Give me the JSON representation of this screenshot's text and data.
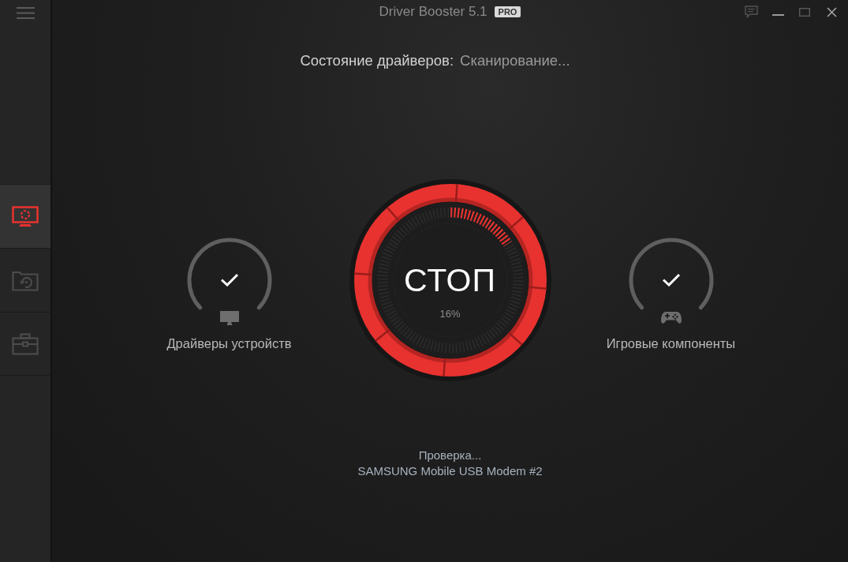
{
  "window": {
    "title": "Driver Booster 5.1",
    "badge": "PRO"
  },
  "sidebar": {
    "items": [
      {
        "kind": "scan",
        "selected": true
      },
      {
        "kind": "restore",
        "selected": false
      },
      {
        "kind": "toolbox",
        "selected": false
      }
    ]
  },
  "status": {
    "label": "Состояние драйверов:",
    "value": "Сканирование..."
  },
  "categories": [
    {
      "kind": "devices",
      "label": "Драйверы устройств",
      "done": true
    },
    {
      "kind": "games",
      "label": "Игровые компоненты",
      "done": true
    }
  ],
  "scan": {
    "button": "СТОП",
    "percent": "16%",
    "level": 0.16
  },
  "progress": {
    "label": "Проверка...",
    "item": "SAMSUNG Mobile USB Modem #2"
  }
}
